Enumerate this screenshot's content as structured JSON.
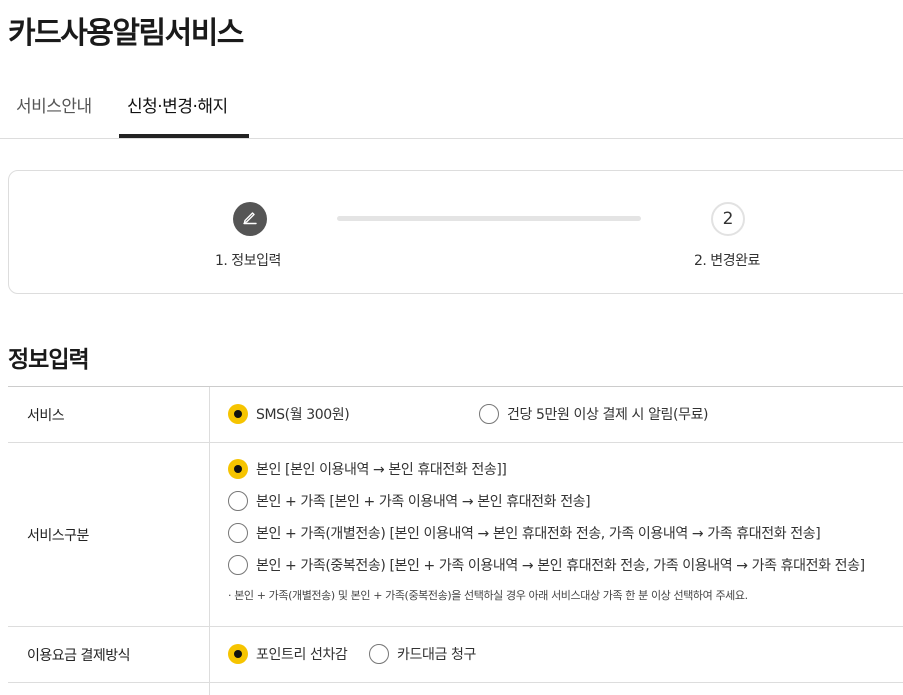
{
  "page": {
    "title": "카드사용알림서비스"
  },
  "tabs": [
    {
      "label": "서비스안내"
    },
    {
      "label": "신청·변경·해지"
    }
  ],
  "steps": [
    {
      "label": "1. 정보입력",
      "icon": "pencil-icon"
    },
    {
      "number": "2",
      "label": "2. 변경완료"
    }
  ],
  "section": {
    "title": "정보입력"
  },
  "form": {
    "service": {
      "label": "서비스",
      "options": [
        {
          "label": "SMS(월 300원)",
          "selected": true
        },
        {
          "label": "건당 5만원 이상 결제 시 알림(무료)",
          "selected": false
        }
      ]
    },
    "service_type": {
      "label": "서비스구분",
      "options": [
        {
          "label": "본인 [본인 이용내역 → 본인 휴대전화 전송]]",
          "selected": true
        },
        {
          "label": "본인 + 가족 [본인 + 가족 이용내역 → 본인 휴대전화 전송]",
          "selected": false
        },
        {
          "label": "본인 + 가족(개별전송) [본인 이용내역 → 본인 휴대전화 전송, 가족 이용내역 → 가족 휴대전화 전송]",
          "selected": false
        },
        {
          "label": "본인 + 가족(중복전송) [본인 + 가족 이용내역 → 본인 휴대전화 전송, 가족 이용내역 → 가족 휴대전화 전송]",
          "selected": false
        }
      ],
      "note": "· 본인 + 가족(개별전송) 및 본인 + 가족(중복전송)을 선택하실 경우 아래 서비스대상 가족 한 분 이상 선택하여 주세요."
    },
    "payment": {
      "label": "이용요금 결제방식",
      "options": [
        {
          "label": "포인트리 선차감",
          "selected": true
        },
        {
          "label": "카드대금 청구",
          "selected": false
        }
      ]
    }
  },
  "colors": {
    "accent": "#f6c400",
    "step_active": "#555555"
  }
}
